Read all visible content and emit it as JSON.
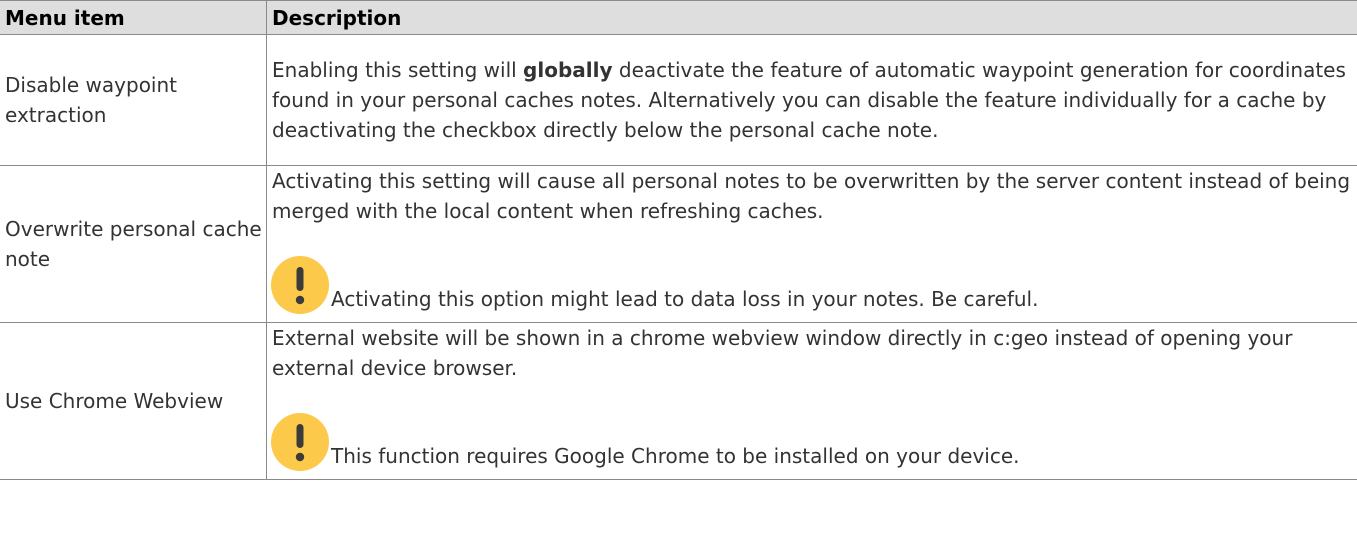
{
  "table": {
    "headers": [
      "Menu item",
      "Description"
    ],
    "rows": [
      {
        "item": "Disable waypoint extraction",
        "desc_prefix": "Enabling this setting will ",
        "desc_bold": "globally",
        "desc_suffix": " deactivate the feature of automatic waypoint generation for coordinates found in your personal caches notes. Alternatively you can disable the feature individually for a cache by deactivating the checkbox directly below the personal cache note."
      },
      {
        "item": "Overwrite personal cache note",
        "desc": "Activating this setting will cause all personal notes to be overwritten by the server content instead of being merged with the local content when refreshing caches.",
        "warning": "Activating this option might lead to data loss in your notes. Be careful."
      },
      {
        "item": "Use Chrome Webview",
        "desc": "External website will be shown in a chrome webview window directly in c:geo instead of opening your external device browser.",
        "warning": "This function requires Google Chrome to be installed on your device."
      }
    ]
  },
  "colors": {
    "header_bg": "#dedede",
    "border": "#8a8a8a",
    "warning_icon": "#fcc94a"
  },
  "icons": {
    "warning": "exclamation-warning-icon"
  }
}
